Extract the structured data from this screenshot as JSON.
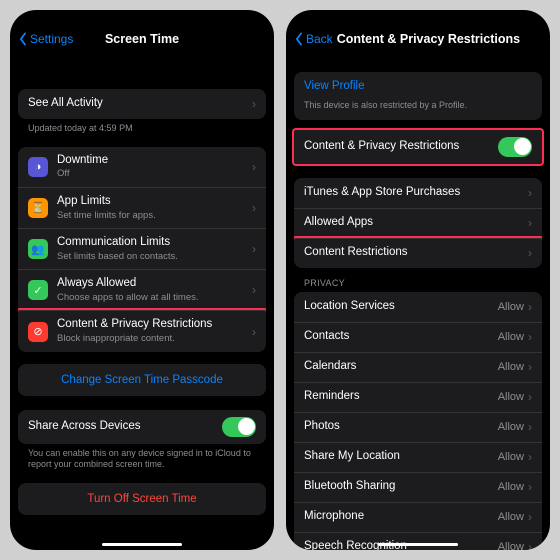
{
  "left": {
    "back": "Settings",
    "title": "Screen Time",
    "see_all": "See All Activity",
    "updated": "Updated today at 4:59 PM",
    "rows": {
      "downtime": {
        "label": "Downtime",
        "sub": "Off"
      },
      "applimits": {
        "label": "App Limits",
        "sub": "Set time limits for apps."
      },
      "comm": {
        "label": "Communication Limits",
        "sub": "Set limits based on contacts."
      },
      "always": {
        "label": "Always Allowed",
        "sub": "Choose apps to allow at all times."
      },
      "content": {
        "label": "Content & Privacy Restrictions",
        "sub": "Block inappropriate content."
      }
    },
    "change_passcode": "Change Screen Time Passcode",
    "share": {
      "label": "Share Across Devices",
      "note": "You can enable this on any device signed in to iCloud to report your combined screen time."
    },
    "turn_off": "Turn Off Screen Time"
  },
  "right": {
    "back": "Back",
    "title": "Content & Privacy Restrictions",
    "view_profile": "View Profile",
    "profile_note": "This device is also restricted by a Profile.",
    "toggle_label": "Content & Privacy Restrictions",
    "rows": {
      "itunes": "iTunes & App Store Purchases",
      "allowed": "Allowed Apps",
      "content": "Content Restrictions"
    },
    "privacy_header": "PRIVACY",
    "privacy": [
      {
        "label": "Location Services",
        "value": "Allow"
      },
      {
        "label": "Contacts",
        "value": "Allow"
      },
      {
        "label": "Calendars",
        "value": "Allow"
      },
      {
        "label": "Reminders",
        "value": "Allow"
      },
      {
        "label": "Photos",
        "value": "Allow"
      },
      {
        "label": "Share My Location",
        "value": "Allow"
      },
      {
        "label": "Bluetooth Sharing",
        "value": "Allow"
      },
      {
        "label": "Microphone",
        "value": "Allow"
      },
      {
        "label": "Speech Recognition",
        "value": "Allow"
      }
    ]
  }
}
